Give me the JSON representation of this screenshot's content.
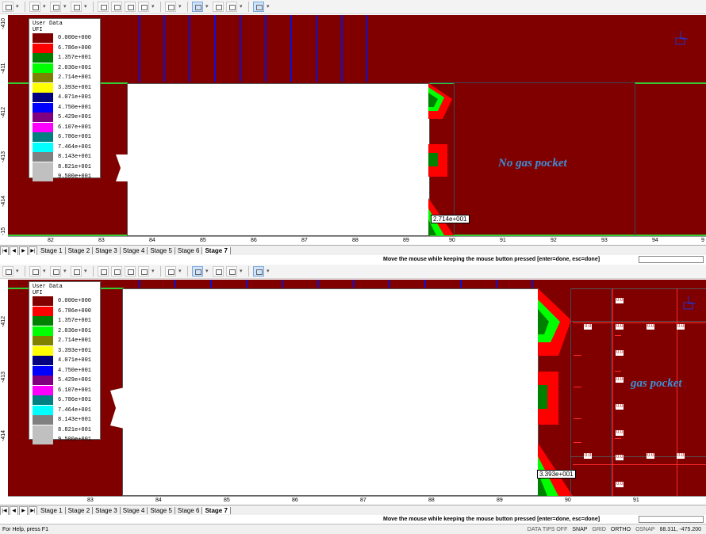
{
  "legend": {
    "title_line1": "User Data",
    "title_line2": "UFI",
    "entries": [
      {
        "value": "0.000e+000",
        "color": "#800000"
      },
      {
        "value": "6.786e+000",
        "color": "#ff0000"
      },
      {
        "value": "1.357e+001",
        "color": "#008000"
      },
      {
        "value": "2.036e+001",
        "color": "#00ff00"
      },
      {
        "value": "2.714e+001",
        "color": "#808000"
      },
      {
        "value": "3.393e+001",
        "color": "#ffff00"
      },
      {
        "value": "4.071e+001",
        "color": "#000080"
      },
      {
        "value": "4.750e+001",
        "color": "#0000ff"
      },
      {
        "value": "5.429e+001",
        "color": "#800080"
      },
      {
        "value": "6.107e+001",
        "color": "#ff00ff"
      },
      {
        "value": "6.786e+001",
        "color": "#008080"
      },
      {
        "value": "7.464e+001",
        "color": "#00ffff"
      },
      {
        "value": "8.143e+001",
        "color": "#808080"
      },
      {
        "value": "8.821e+001",
        "color": "#c0c0c0"
      },
      {
        "value": "9.500e+001",
        "color": "#c0c0c0"
      }
    ]
  },
  "view1": {
    "left_ticks": [
      "-410",
      "-411",
      "-412",
      "-413",
      "-414",
      "-15"
    ],
    "bottom_ticks": [
      "82",
      "83",
      "84",
      "85",
      "86",
      "87",
      "88",
      "89",
      "90",
      "91",
      "92",
      "93",
      "94",
      "9"
    ],
    "probe_value": "2.714e+001",
    "annotation": "No gas pocket"
  },
  "view2": {
    "left_ticks": [
      "-412",
      "-413",
      "-414"
    ],
    "bottom_ticks": [
      "83",
      "84",
      "85",
      "86",
      "87",
      "88",
      "89",
      "90",
      "91"
    ],
    "probe_value": "3.393e+001",
    "annotation": "gas pocket",
    "gas_labels": [
      "0.0",
      "0.0",
      "0.0",
      "0.0",
      "0.0",
      "0.0",
      "0.0",
      "0.0",
      "0.0",
      "0.0",
      "0.0",
      "0.0",
      "0.0",
      "0.0"
    ]
  },
  "tabs": [
    "Stage 1",
    "Stage 2",
    "Stage 3",
    "Stage 4",
    "Stage 5",
    "Stage 6",
    "Stage 7"
  ],
  "active_tab": "Stage 7",
  "command_prompt": "Move the mouse while keeping the mouse button pressed [enter=done, esc=done]",
  "command_input_value": "",
  "status": {
    "help": "For Help, press F1",
    "data_tips": "DATA TIPS OFF",
    "snap": "SNAP",
    "grid": "GRID",
    "ortho": "ORTHO",
    "osnap": "OSNAP",
    "coords": "88.311,  -475.200"
  },
  "icons": [
    "select-icon",
    "zoom-icon",
    "rectangle-icon",
    "polyline-icon",
    "interpret-icon",
    "mesh-icon",
    "graph-icon",
    "query-icon",
    "contour-icon",
    "display-icon"
  ]
}
